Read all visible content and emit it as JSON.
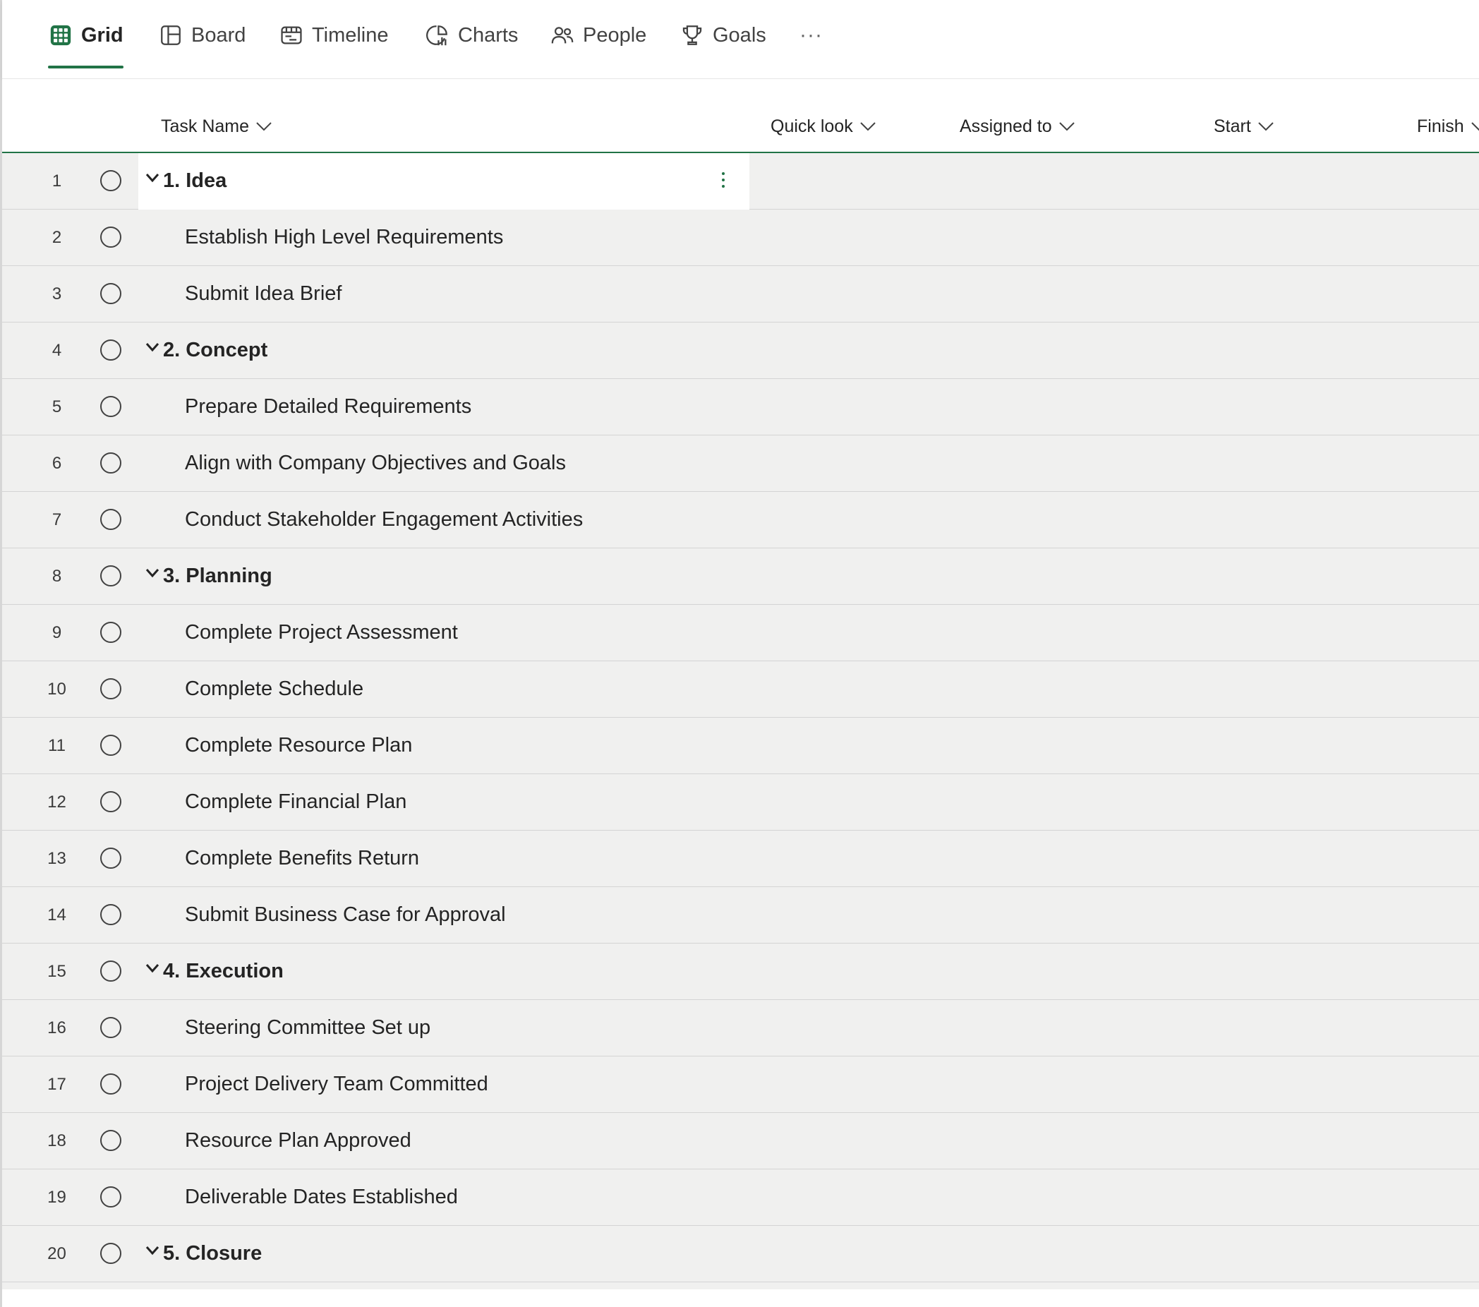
{
  "tabs": [
    {
      "label": "Grid",
      "icon": "grid-icon",
      "active": true
    },
    {
      "label": "Board",
      "icon": "board-icon",
      "active": false
    },
    {
      "label": "Timeline",
      "icon": "timeline-icon",
      "active": false
    },
    {
      "label": "Charts",
      "icon": "charts-icon",
      "active": false
    },
    {
      "label": "People",
      "icon": "people-icon",
      "active": false
    },
    {
      "label": "Goals",
      "icon": "trophy-icon",
      "active": false
    }
  ],
  "more_label": "···",
  "columns": {
    "task_name": "Task Name",
    "quick_look": "Quick look",
    "assigned_to": "Assigned to",
    "start": "Start",
    "finish": "Finish"
  },
  "accent_color": "#217346",
  "rows": [
    {
      "num": "1",
      "name": "1. Idea",
      "summary": true,
      "selected": true
    },
    {
      "num": "2",
      "name": "Establish High Level Requirements",
      "summary": false
    },
    {
      "num": "3",
      "name": "Submit Idea Brief",
      "summary": false
    },
    {
      "num": "4",
      "name": "2. Concept",
      "summary": true
    },
    {
      "num": "5",
      "name": "Prepare Detailed Requirements",
      "summary": false
    },
    {
      "num": "6",
      "name": "Align with Company Objectives and Goals",
      "summary": false
    },
    {
      "num": "7",
      "name": "Conduct Stakeholder Engagement Activities",
      "summary": false
    },
    {
      "num": "8",
      "name": "3. Planning",
      "summary": true
    },
    {
      "num": "9",
      "name": "Complete Project Assessment",
      "summary": false
    },
    {
      "num": "10",
      "name": "Complete Schedule",
      "summary": false
    },
    {
      "num": "11",
      "name": "Complete Resource Plan",
      "summary": false
    },
    {
      "num": "12",
      "name": "Complete Financial Plan",
      "summary": false
    },
    {
      "num": "13",
      "name": "Complete Benefits Return",
      "summary": false
    },
    {
      "num": "14",
      "name": "Submit Business Case for Approval",
      "summary": false
    },
    {
      "num": "15",
      "name": "4. Execution",
      "summary": true
    },
    {
      "num": "16",
      "name": "Steering Committee Set up",
      "summary": false
    },
    {
      "num": "17",
      "name": "Project Delivery Team Committed",
      "summary": false
    },
    {
      "num": "18",
      "name": "Resource Plan Approved",
      "summary": false
    },
    {
      "num": "19",
      "name": "Deliverable Dates Established",
      "summary": false
    },
    {
      "num": "20",
      "name": "5. Closure",
      "summary": true
    }
  ]
}
